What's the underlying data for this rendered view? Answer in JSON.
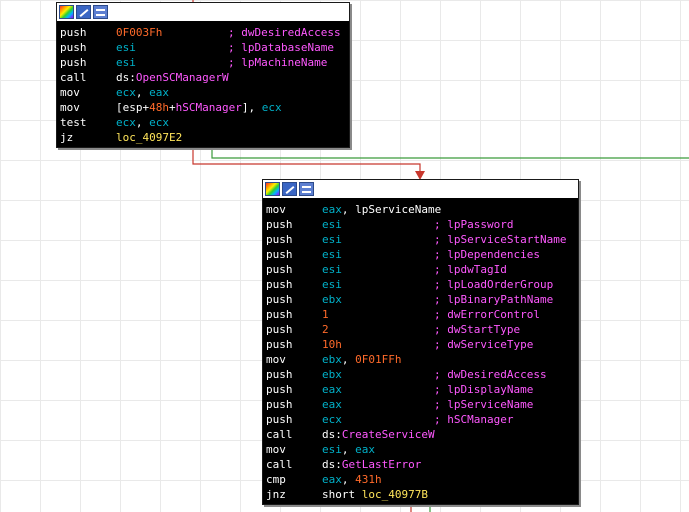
{
  "header_icons": [
    "color-palette-icon",
    "edit-icon",
    "graph-view-icon"
  ],
  "colors": {
    "background": "#ffffff",
    "node_bg": "#000000",
    "mnemonic": "#ffffff",
    "register": "#00b0c8",
    "number": "#ff6a2a",
    "api": "#ff59ff",
    "label": "#ffe55a",
    "edge_false": "#c8372d",
    "edge_true": "#3a9a3a",
    "edge_plain": "#c8372d"
  },
  "block1": {
    "lines": [
      {
        "mnemonic": "push",
        "operand": [
          {
            "t": "0F003Fh",
            "c": "num"
          }
        ],
        "comment": "; dwDesiredAccess"
      },
      {
        "mnemonic": "push",
        "operand": [
          {
            "t": "esi",
            "c": "reg"
          }
        ],
        "comment": "; lpDatabaseName"
      },
      {
        "mnemonic": "push",
        "operand": [
          {
            "t": "esi",
            "c": "reg"
          }
        ],
        "comment": "; lpMachineName"
      },
      {
        "mnemonic": "call",
        "operand": [
          {
            "t": "ds:",
            "c": "plain"
          },
          {
            "t": "OpenSCManagerW",
            "c": "api"
          }
        ],
        "comment": ""
      },
      {
        "mnemonic": "mov",
        "operand": [
          {
            "t": "ecx",
            "c": "reg"
          },
          {
            "t": ", ",
            "c": "plain"
          },
          {
            "t": "eax",
            "c": "reg"
          }
        ],
        "comment": ""
      },
      {
        "mnemonic": "mov",
        "operand": [
          {
            "t": "[esp+",
            "c": "plain"
          },
          {
            "t": "48h",
            "c": "num"
          },
          {
            "t": "+",
            "c": "plain"
          },
          {
            "t": "hSCManager",
            "c": "api"
          },
          {
            "t": "], ",
            "c": "plain"
          },
          {
            "t": "ecx",
            "c": "reg"
          }
        ],
        "comment": ""
      },
      {
        "mnemonic": "test",
        "operand": [
          {
            "t": "ecx",
            "c": "reg"
          },
          {
            "t": ", ",
            "c": "plain"
          },
          {
            "t": "ecx",
            "c": "reg"
          }
        ],
        "comment": ""
      },
      {
        "mnemonic": "jz",
        "operand": [
          {
            "t": "loc_4097E2",
            "c": "label"
          }
        ],
        "comment": ""
      }
    ]
  },
  "block2": {
    "lines": [
      {
        "mnemonic": "mov",
        "operand": [
          {
            "t": "eax",
            "c": "reg"
          },
          {
            "t": ", lpServiceName",
            "c": "plain"
          }
        ],
        "comment": ""
      },
      {
        "mnemonic": "push",
        "operand": [
          {
            "t": "esi",
            "c": "reg"
          }
        ],
        "comment": "; lpPassword"
      },
      {
        "mnemonic": "push",
        "operand": [
          {
            "t": "esi",
            "c": "reg"
          }
        ],
        "comment": "; lpServiceStartName"
      },
      {
        "mnemonic": "push",
        "operand": [
          {
            "t": "esi",
            "c": "reg"
          }
        ],
        "comment": "; lpDependencies"
      },
      {
        "mnemonic": "push",
        "operand": [
          {
            "t": "esi",
            "c": "reg"
          }
        ],
        "comment": "; lpdwTagId"
      },
      {
        "mnemonic": "push",
        "operand": [
          {
            "t": "esi",
            "c": "reg"
          }
        ],
        "comment": "; lpLoadOrderGroup"
      },
      {
        "mnemonic": "push",
        "operand": [
          {
            "t": "ebx",
            "c": "reg"
          }
        ],
        "comment": "; lpBinaryPathName"
      },
      {
        "mnemonic": "push",
        "operand": [
          {
            "t": "1",
            "c": "num"
          }
        ],
        "comment": "; dwErrorControl"
      },
      {
        "mnemonic": "push",
        "operand": [
          {
            "t": "2",
            "c": "num"
          }
        ],
        "comment": "; dwStartType"
      },
      {
        "mnemonic": "push",
        "operand": [
          {
            "t": "10h",
            "c": "num"
          }
        ],
        "comment": "; dwServiceType"
      },
      {
        "mnemonic": "mov",
        "operand": [
          {
            "t": "ebx",
            "c": "reg"
          },
          {
            "t": ", ",
            "c": "plain"
          },
          {
            "t": "0F01FFh",
            "c": "num"
          }
        ],
        "comment": ""
      },
      {
        "mnemonic": "push",
        "operand": [
          {
            "t": "ebx",
            "c": "reg"
          }
        ],
        "comment": "; dwDesiredAccess"
      },
      {
        "mnemonic": "push",
        "operand": [
          {
            "t": "eax",
            "c": "reg"
          }
        ],
        "comment": "; lpDisplayName"
      },
      {
        "mnemonic": "push",
        "operand": [
          {
            "t": "eax",
            "c": "reg"
          }
        ],
        "comment": "; lpServiceName"
      },
      {
        "mnemonic": "push",
        "operand": [
          {
            "t": "ecx",
            "c": "reg"
          }
        ],
        "comment": "; hSCManager"
      },
      {
        "mnemonic": "call",
        "operand": [
          {
            "t": "ds:",
            "c": "plain"
          },
          {
            "t": "CreateServiceW",
            "c": "api"
          }
        ],
        "comment": ""
      },
      {
        "mnemonic": "mov",
        "operand": [
          {
            "t": "esi",
            "c": "reg"
          },
          {
            "t": ", ",
            "c": "plain"
          },
          {
            "t": "eax",
            "c": "reg"
          }
        ],
        "comment": ""
      },
      {
        "mnemonic": "call",
        "operand": [
          {
            "t": "ds:",
            "c": "plain"
          },
          {
            "t": "GetLastError",
            "c": "api"
          }
        ],
        "comment": ""
      },
      {
        "mnemonic": "cmp",
        "operand": [
          {
            "t": "eax",
            "c": "reg"
          },
          {
            "t": ", ",
            "c": "plain"
          },
          {
            "t": "431h",
            "c": "num"
          }
        ],
        "comment": ""
      },
      {
        "mnemonic": "jnz",
        "operand": [
          {
            "t": "short ",
            "c": "plain"
          },
          {
            "t": "loc_40977B",
            "c": "label"
          }
        ],
        "comment": ""
      }
    ]
  }
}
